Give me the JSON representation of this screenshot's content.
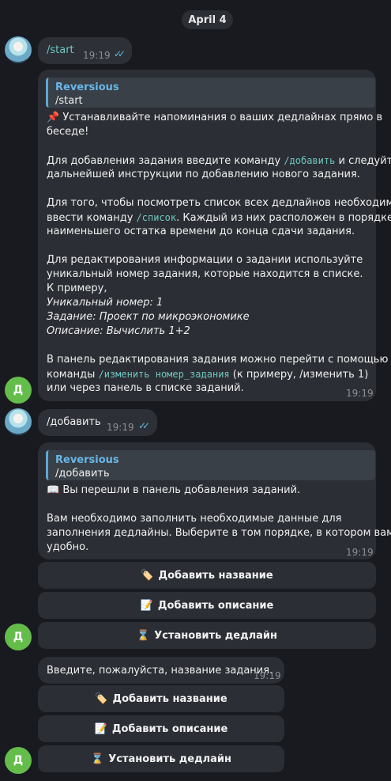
{
  "date_separator": "April 4",
  "messages": {
    "start_cmd": {
      "text": "/start",
      "time": "19:19"
    },
    "start_reply": {
      "reply_name": "Reversious",
      "reply_text": "/start",
      "lines": [
        "📌 Устанавливайте напоминания о ваших дедлайнах прямо в",
        "беседе!",
        "Для добавления задания введите команду",
        "/добавить",
        "и следуйте",
        "дальнейшей инструкции по добавлению нового задания.",
        "Для того, чтобы посмотреть список всех дедлайнов необходимо",
        "ввести команду",
        "/список",
        ". Каждый из них расположен в порядке",
        "наименьшего остатка времени до конца сдачи задания.",
        "Для редактирования информации о задании используйте",
        "уникальный номер задания, которые находится в списке.",
        "К примеру,",
        "Уникальный номер: 1",
        "Задание: Проект по микроэкономике",
        "Описание: Вычислить 1+2",
        "В панель редактирования задания можно перейти с помощью",
        "команды",
        "/изменить номер_задания",
        "(к примеру, /изменить 1)",
        "или через панель в списке заданий."
      ],
      "time": "19:19",
      "avatar_letter": "Д"
    },
    "add_cmd": {
      "text": "/добавить",
      "time": "19:19"
    },
    "add_reply": {
      "reply_name": "Reversious",
      "reply_text": "/добавить",
      "lines": [
        "📖 Вы перешли в панель добавления заданий.",
        "Вам необходимо заполнить необходимые данные для",
        "заполнения дедлайны. Выберите в том порядке, в котором вам",
        "удобно."
      ],
      "time": "19:19",
      "buttons": [
        {
          "icon": "🏷️",
          "label": "Добавить название"
        },
        {
          "icon": "📝",
          "label": "Добавить описание"
        },
        {
          "icon": "⌛",
          "label": "Установить дедлайн"
        }
      ],
      "avatar_letter": "Д"
    },
    "name_prompt": {
      "text": "Введите, пожалуйста, название задания.",
      "time": "19:19",
      "buttons": [
        {
          "icon": "🏷️",
          "label": "Добавить название"
        },
        {
          "icon": "📝",
          "label": "Добавить описание"
        },
        {
          "icon": "⌛",
          "label": "Установить дедлайн"
        }
      ],
      "avatar_letter": "Д"
    }
  }
}
